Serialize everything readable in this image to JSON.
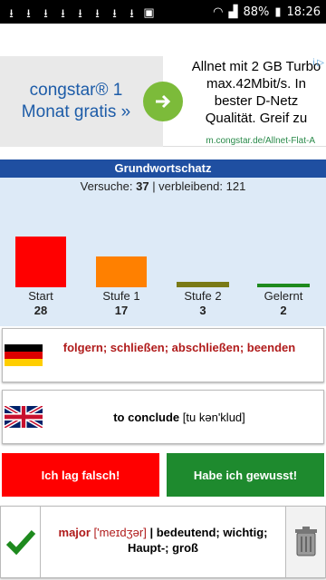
{
  "status_bar": {
    "battery": "88%",
    "time": "18:26"
  },
  "ad": {
    "left_text": "congstar® 1 Monat gratis »",
    "right_text": "Allnet mit 2 GB Turbo max.42Mbit/s. In bester D-Netz Qualität. Greif zu",
    "url": "m.congstar.de/Allnet-Flat-A",
    "badge": "i ▷"
  },
  "header": {
    "title": "Grundwortschatz"
  },
  "counts": {
    "attempts_label": "Versuche:",
    "attempts_value": "37",
    "remaining_label": "| verbleibend:",
    "remaining_value": "121"
  },
  "chart_data": {
    "type": "bar",
    "categories": [
      "Start",
      "Stufe 1",
      "Stufe 2",
      "Gelernt"
    ],
    "values": [
      28,
      17,
      3,
      2
    ],
    "colors": [
      "#ff0000",
      "#ff8000",
      "#7a7a16",
      "#1e8a1e"
    ]
  },
  "cards": {
    "german_text": "folgern; schließen; abschließen; beenden",
    "english_word": "to conclude",
    "english_pron": "[tu kən'klud]"
  },
  "buttons": {
    "wrong_label": "Ich lag falsch!",
    "right_label": "Habe ich gewusst!"
  },
  "bottom": {
    "word": "major",
    "pron": "['meɪdʒər]",
    "separator": "|",
    "meaning": "bedeutend; wichtig; Haupt-; groß"
  }
}
